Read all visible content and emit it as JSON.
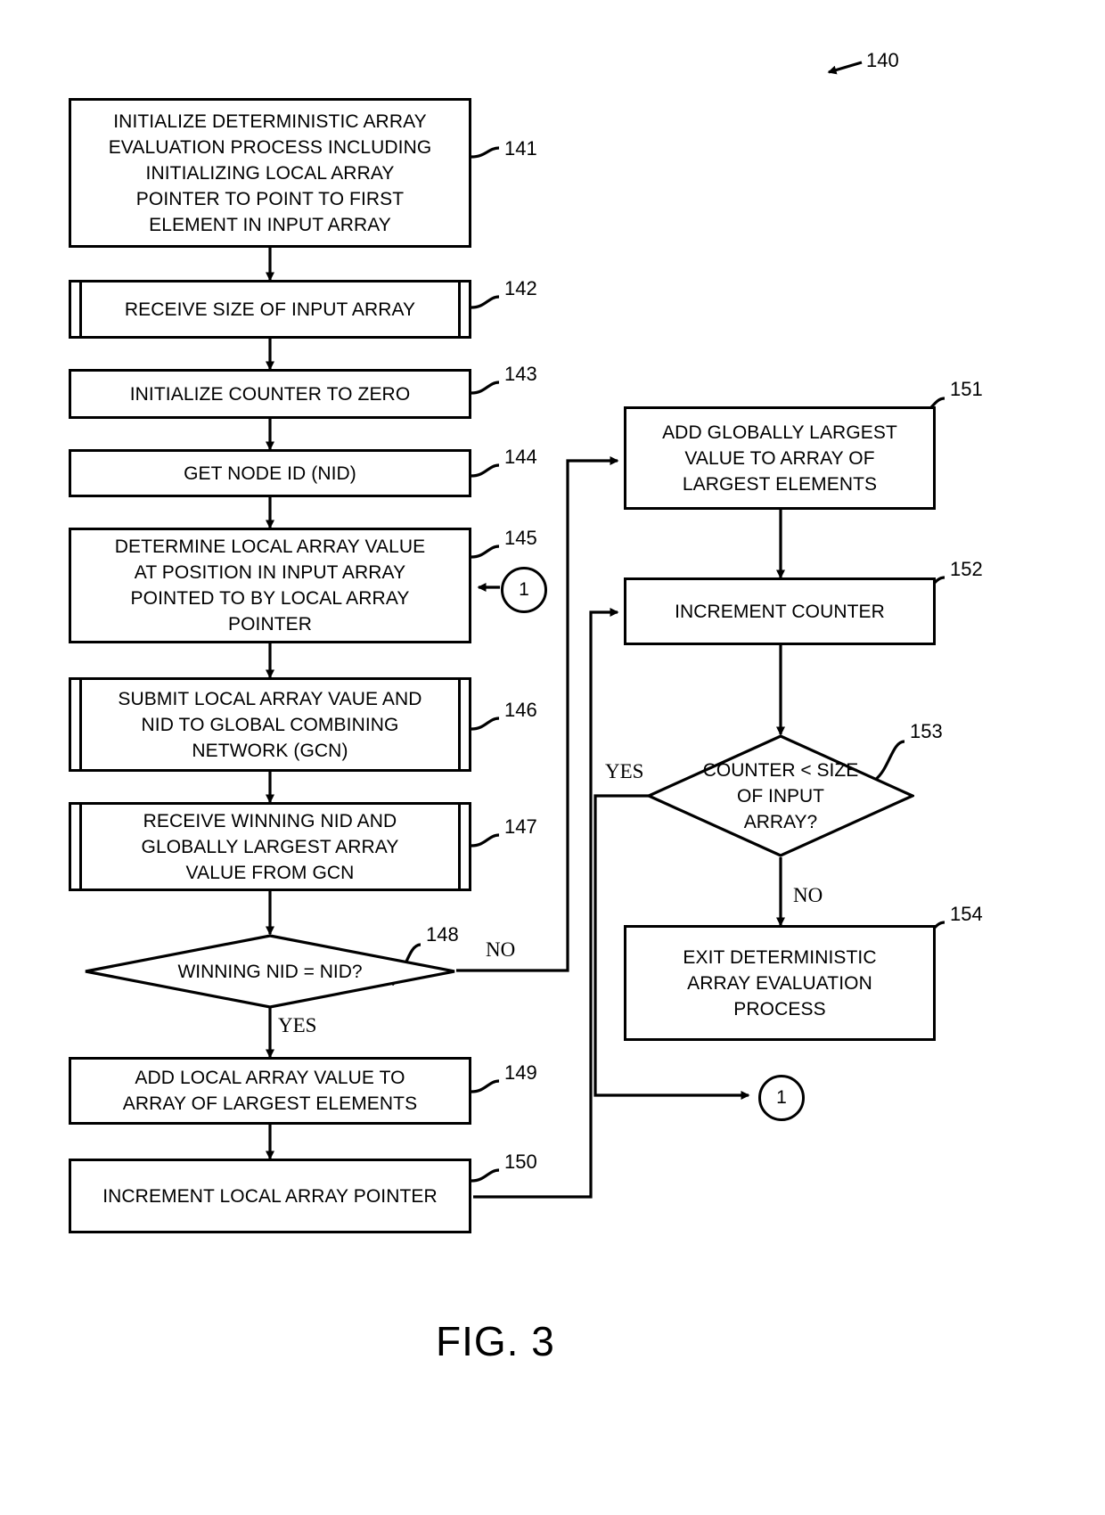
{
  "figure": {
    "caption": "FIG. 3",
    "figure_ref": "140"
  },
  "nodes": {
    "n141": {
      "ref": "141",
      "shape": "process",
      "text": "INITIALIZE DETERMINISTIC ARRAY\nEVALUATION PROCESS INCLUDING\nINITIALIZING LOCAL ARRAY\nPOINTER TO POINT TO FIRST\nELEMENT IN INPUT ARRAY"
    },
    "n142": {
      "ref": "142",
      "shape": "predefined-process",
      "text": "RECEIVE SIZE OF INPUT ARRAY"
    },
    "n143": {
      "ref": "143",
      "shape": "process",
      "text": "INITIALIZE COUNTER TO ZERO"
    },
    "n144": {
      "ref": "144",
      "shape": "process",
      "text": "GET NODE ID (NID)"
    },
    "n145": {
      "ref": "145",
      "shape": "process",
      "text": "DETERMINE LOCAL ARRAY VALUE\nAT POSITION IN INPUT ARRAY\nPOINTED TO BY LOCAL ARRAY\nPOINTER"
    },
    "n146": {
      "ref": "146",
      "shape": "predefined-process",
      "text": "SUBMIT LOCAL ARRAY VAUE AND\nNID TO GLOBAL COMBINING\nNETWORK (GCN)"
    },
    "n147": {
      "ref": "147",
      "shape": "predefined-process",
      "text": "RECEIVE WINNING NID AND\nGLOBALLY LARGEST ARRAY\nVALUE FROM GCN"
    },
    "n148": {
      "ref": "148",
      "shape": "decision",
      "text": "WINNING NID = NID?",
      "yes_label": "YES",
      "no_label": "NO"
    },
    "n149": {
      "ref": "149",
      "shape": "process",
      "text": "ADD LOCAL ARRAY VALUE TO\nARRAY OF LARGEST ELEMENTS"
    },
    "n150": {
      "ref": "150",
      "shape": "process",
      "text": "INCREMENT LOCAL ARRAY POINTER"
    },
    "n151": {
      "ref": "151",
      "shape": "process",
      "text": "ADD GLOBALLY LARGEST\nVALUE TO ARRAY OF\nLARGEST ELEMENTS"
    },
    "n152": {
      "ref": "152",
      "shape": "process",
      "text": "INCREMENT COUNTER"
    },
    "n153": {
      "ref": "153",
      "shape": "decision",
      "text": "COUNTER < SIZE\nOF INPUT\nARRAY?",
      "yes_label": "YES",
      "no_label": "NO"
    },
    "n154": {
      "ref": "154",
      "shape": "process",
      "text": "EXIT DETERMINISTIC\nARRAY EVALUATION\nPROCESS"
    }
  },
  "connectors": {
    "circle_left": "1",
    "circle_right": "1"
  }
}
